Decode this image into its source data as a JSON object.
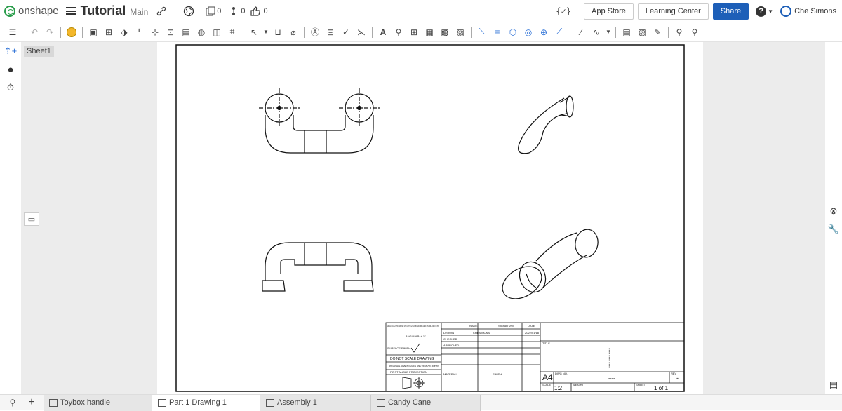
{
  "app": {
    "brand": "onshape",
    "document_name": "Tutorial",
    "workspace": "Main"
  },
  "header": {
    "versions_count": "0",
    "branches_count": "0",
    "likes_count": "0",
    "app_store": "App Store",
    "learning_center": "Learning Center",
    "share": "Share",
    "user_name": "Che Simons",
    "help_glyph": "?"
  },
  "sheets": {
    "sheet1": "Sheet1"
  },
  "title_block": {
    "general_note": "UNLESS OTHERWISE SPECIFIED: DIMENSIONS ARE IN MILLIMETERS",
    "angular": "ANGULAR: ± 1°",
    "surface_finish": "SURFACE FINISH",
    "do_not_scale": "DO NOT SCALE DRAWING",
    "break_edges": "BREAK ALL SHARP EDGES AND REMOVE BURRS",
    "projection": "FIRST ANGLE PROJECTION",
    "col_name": "NAME",
    "col_signature": "SIGNATURE",
    "col_date": "DATE",
    "row_drawn": "DRAWN",
    "row_checked": "CHECKED",
    "row_approved": "APPROVED",
    "drawn_name": "CHESIMONS",
    "drawn_date": "2022/01/18",
    "material": "MATERIAL",
    "finish": "FINISH",
    "title_label": "TITLE",
    "size": "A4",
    "dwg_no_label": "DWG NO.",
    "rev_label": "REV",
    "scale_label": "SCALE",
    "scale": "1:2",
    "weight_label": "WEIGHT",
    "sheet_label": "SHEET",
    "sheet_value": "1 of 1",
    "dashes": "----",
    "rev_value": "-"
  },
  "tabs": [
    {
      "label": "Toybox handle"
    },
    {
      "label": "Part 1 Drawing 1"
    },
    {
      "label": "Assembly 1"
    },
    {
      "label": "Candy Cane"
    }
  ],
  "colors": {
    "share_blue": "#1d5fb8",
    "onshape_green": "#2a9d4b",
    "panel_gray": "#ececec"
  }
}
